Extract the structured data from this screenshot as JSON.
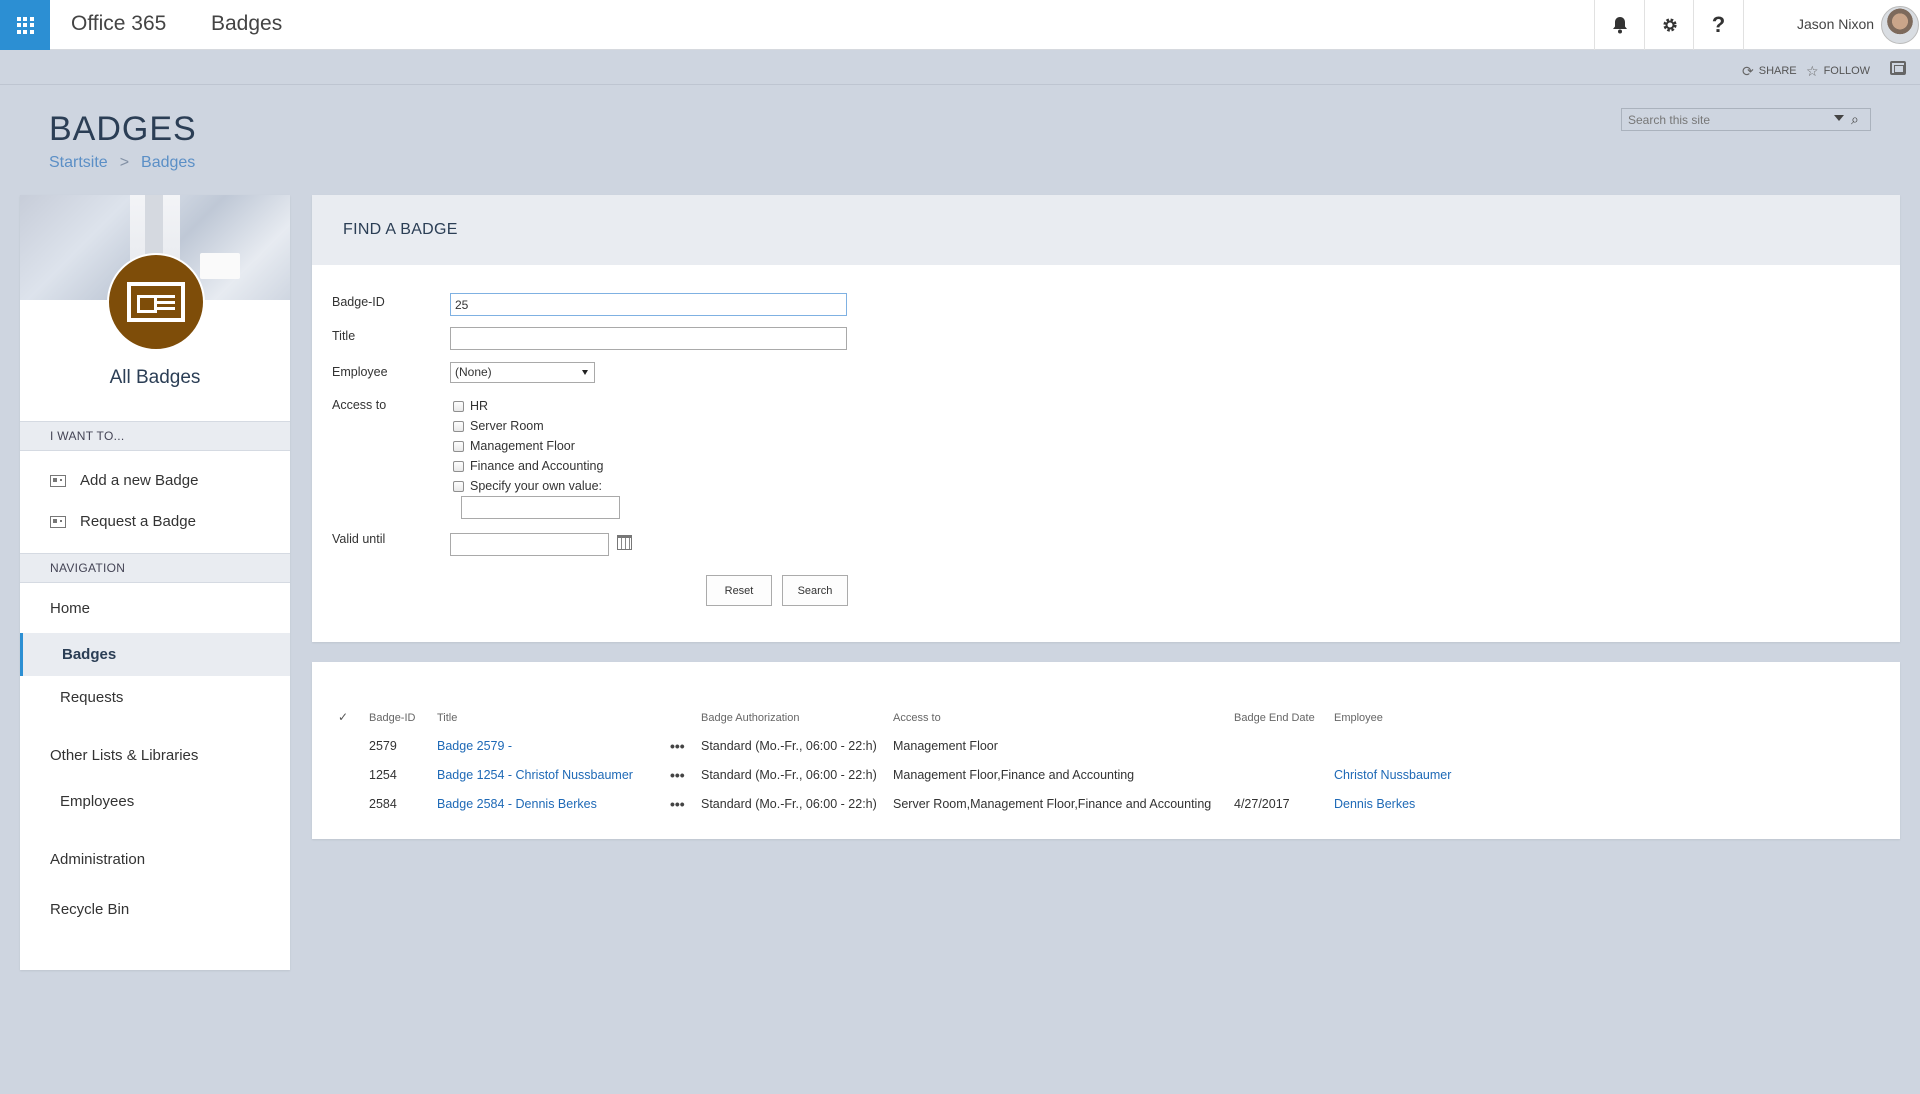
{
  "suitebar": {
    "brand": "Office 365",
    "app_name": "Badges",
    "user_name": "Jason Nixon",
    "accent": "#2c8fd3"
  },
  "actions": {
    "share": "SHARE",
    "follow": "FOLLOW"
  },
  "page": {
    "title": "BADGES",
    "breadcrumb": [
      "Startsite",
      "Badges"
    ],
    "breadcrumb_sep": ">",
    "search_placeholder": "Search this site"
  },
  "sidebar": {
    "title": "All Badges",
    "badge_color": "#7e4d09",
    "i_want_to": {
      "heading": "I WANT TO...",
      "items": [
        "Add a new Badge",
        "Request a Badge"
      ]
    },
    "navigation": {
      "heading": "NAVIGATION",
      "items": [
        {
          "label": "Home"
        },
        {
          "label": "Badges",
          "selected": true
        },
        {
          "label": "Requests"
        },
        {
          "label": "Other Lists & Libraries"
        },
        {
          "label": "Employees"
        },
        {
          "label": "Administration"
        },
        {
          "label": "Recycle Bin"
        }
      ]
    }
  },
  "find": {
    "title": "FIND A BADGE",
    "labels": {
      "badge_id": "Badge-ID",
      "title": "Title",
      "employee": "Employee",
      "access_to": "Access to",
      "valid_until": "Valid until"
    },
    "values": {
      "badge_id": "25",
      "title": "",
      "employee": "(None)",
      "own_value": "",
      "valid_until": ""
    },
    "access_options": [
      "HR",
      "Server Room",
      "Management Floor",
      "Finance and Accounting",
      "Specify your own value:"
    ],
    "buttons": {
      "reset": "Reset",
      "search": "Search"
    }
  },
  "results": {
    "columns": [
      "Badge-ID",
      "Title",
      "Badge Authorization",
      "Access to",
      "Badge End Date",
      "Employee"
    ],
    "check_glyph": "✓",
    "more_glyph": "•••",
    "rows": [
      {
        "id": "2579",
        "title": "Badge 2579 -",
        "auth": "Standard (Mo.-Fr., 06:00 - 22:h)",
        "access": "Management Floor",
        "end_date": "",
        "employee": ""
      },
      {
        "id": "1254",
        "title": "Badge 1254 - Christof Nussbaumer",
        "auth": "Standard (Mo.-Fr., 06:00 - 22:h)",
        "access": "Management Floor,Finance and Accounting",
        "end_date": "",
        "employee": "Christof Nussbaumer"
      },
      {
        "id": "2584",
        "title": "Badge 2584 - Dennis Berkes",
        "auth": "Standard (Mo.-Fr., 06:00 - 22:h)",
        "access": "Server Room,Management Floor,Finance and Accounting",
        "end_date": "4/27/2017",
        "employee": "Dennis Berkes"
      }
    ]
  }
}
